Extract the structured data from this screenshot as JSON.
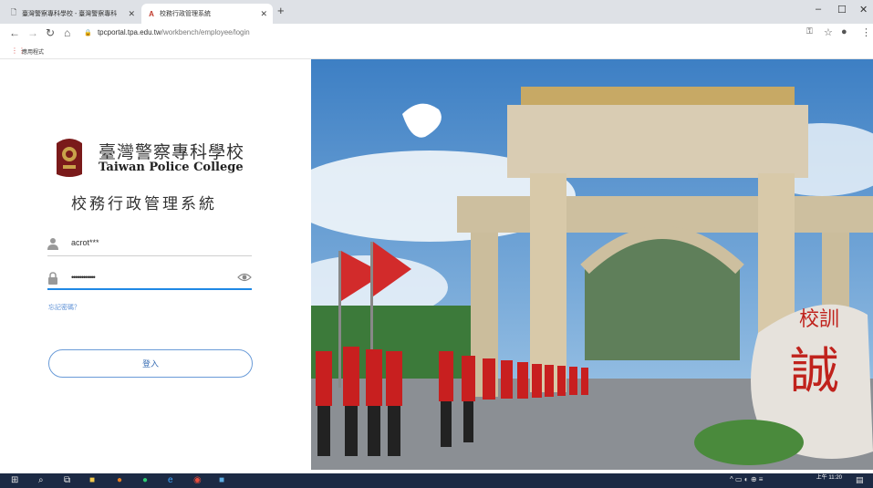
{
  "browser": {
    "tabs": [
      {
        "title": "臺灣警察專科學校 - 臺灣警察專科",
        "active": false
      },
      {
        "title": "校務行政管理系統",
        "active": true
      }
    ],
    "new_tab": "+",
    "window_controls": {
      "minimize": "–",
      "maximize": "☐",
      "close": "✕"
    },
    "address": {
      "host": "tpcportal.tpa.edu.tw",
      "path": "/workbench/employee/login"
    },
    "bookmarks_label": "應用程式"
  },
  "login": {
    "school_name_cn": "臺灣警察專科學校",
    "school_name_en": "Taiwan Police College",
    "system_title": "校務行政管理系統",
    "username_value": "acrot***",
    "password_value": "••••••••••••",
    "forgot_link": "忘記密碼？",
    "login_button": "登入"
  },
  "hero": {
    "stone_motto_small": "校訓",
    "stone_motto_large": "誠"
  },
  "taskbar": {
    "time": "上午 11:20"
  },
  "colors": {
    "accent": "#1e88e5",
    "button_border": "#6a9bd8",
    "taskbar": "#1c2a44",
    "tab_bar": "#dee1e6"
  }
}
